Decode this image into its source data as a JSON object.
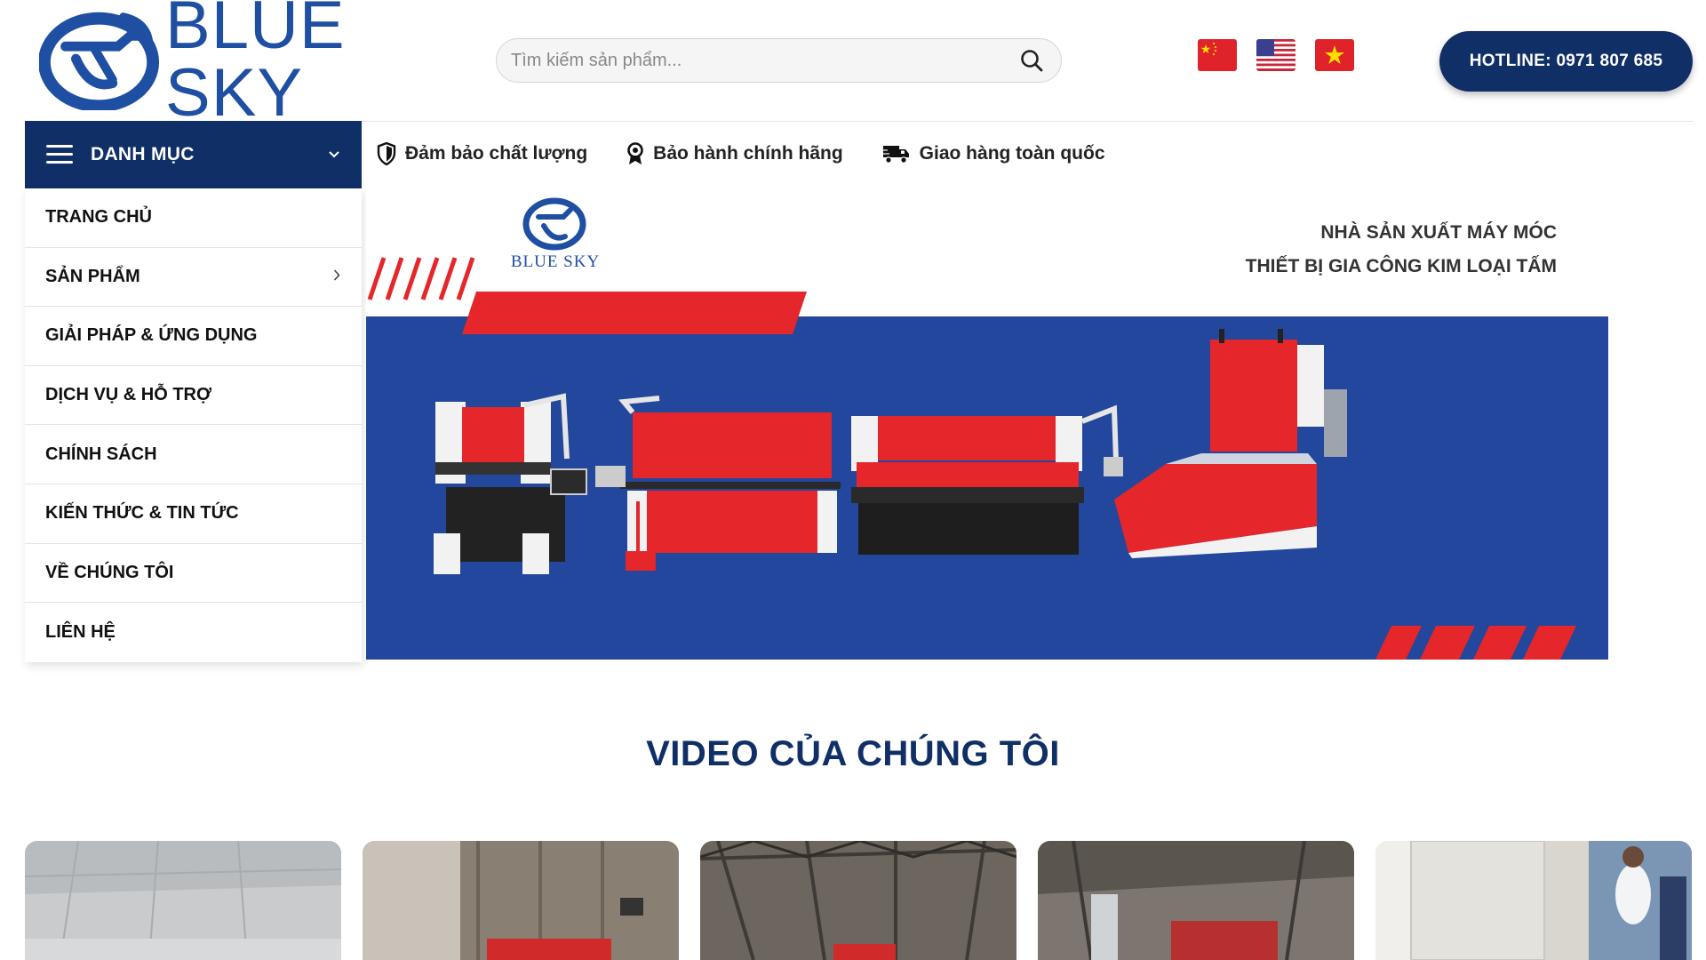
{
  "header": {
    "logo_text": "BLUE SKY",
    "search_placeholder": "Tìm kiếm sản phẩm...",
    "languages": [
      "chinese-flag",
      "us-flag",
      "vietnam-flag"
    ],
    "hotline_label": "HOTLINE:",
    "hotline_number": "0971 807 685"
  },
  "category_menu": {
    "title": "DANH MỤC",
    "items": [
      {
        "label": "TRANG CHỦ"
      },
      {
        "label": "SẢN PHẨM",
        "has_submenu": true
      },
      {
        "label": "GIẢI PHÁP & ỨNG DỤNG"
      },
      {
        "label": "DỊCH VỤ & HỖ TRỢ"
      },
      {
        "label": "CHÍNH SÁCH"
      },
      {
        "label": "KIẾN THỨC & TIN TỨC"
      },
      {
        "label": "VỀ CHÚNG TÔI"
      },
      {
        "label": "LIÊN HỆ"
      }
    ]
  },
  "features": [
    {
      "icon": "shield-icon",
      "label": "Đảm bảo chất lượng"
    },
    {
      "icon": "award-icon",
      "label": "Bảo hành chính hãng"
    },
    {
      "icon": "truck-icon",
      "label": "Giao hàng toàn quốc"
    }
  ],
  "banner": {
    "logo_text": "BLUE SKY",
    "line1": "NHÀ SẢN XUẤT MÁY MÓC",
    "line2": "THIẾT BỊ GIA CÔNG KIM LOẠI TẤM"
  },
  "video_section": {
    "title": "VIDEO CỦA CHÚNG TÔI"
  },
  "colors": {
    "brand_navy": "#102f66",
    "brand_blue": "#1f4fa3",
    "banner_blue": "#22479c",
    "accent_red": "#e5262a"
  }
}
